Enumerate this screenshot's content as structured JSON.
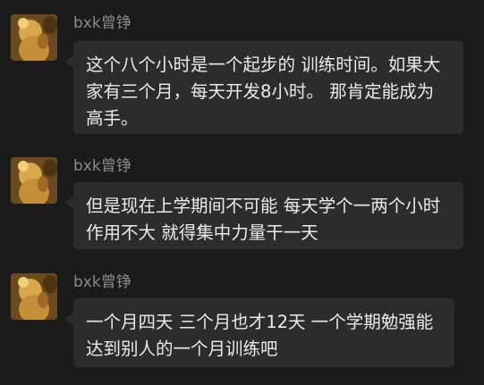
{
  "messages": [
    {
      "sender": "bxk曾铮",
      "avatar": "user-avatar",
      "lines": [
        "这个八个小时是一个起步的 训练时间。如果大",
        "家有三个月，每天开发8小时。 那肯定能成为",
        "高手。"
      ]
    },
    {
      "sender": "bxk曾铮",
      "avatar": "user-avatar",
      "lines": [
        "但是现在上学期间不可能 每天学个一两个小时",
        "作用不大 就得集中力量干一天"
      ]
    },
    {
      "sender": "bxk曾铮",
      "avatar": "user-avatar",
      "lines": [
        "一个月四天 三个月也才12天 一个学期勉强能",
        "达到别人的一个月训练吧"
      ]
    }
  ],
  "colors": {
    "background": "#1b1b1b",
    "bubble": "#2c2c2c",
    "text": "#ebebeb",
    "sender": "#8b8b8b"
  }
}
